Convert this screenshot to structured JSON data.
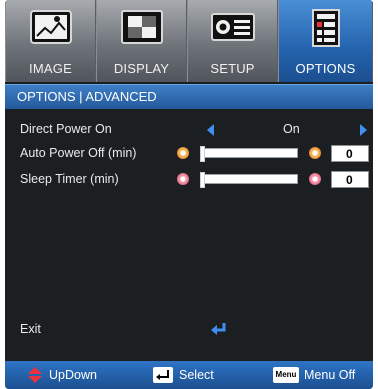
{
  "tabs": [
    {
      "label": "IMAGE",
      "icon": "image-icon"
    },
    {
      "label": "DISPLAY",
      "icon": "display-icon"
    },
    {
      "label": "SETUP",
      "icon": "projector-icon"
    },
    {
      "label": "OPTIONS",
      "icon": "options-icon",
      "active": true
    }
  ],
  "header": {
    "title": "OPTIONS | ADVANCED"
  },
  "settings": {
    "direct_power_on": {
      "label": "Direct Power On",
      "value": "On"
    },
    "auto_power_off": {
      "label": "Auto Power Off (min)",
      "value": "0",
      "slider_level": 0
    },
    "sleep_timer": {
      "label": "Sleep Timer (min)",
      "value": "0",
      "slider_level": 0
    }
  },
  "exit": {
    "label": "Exit"
  },
  "footer": {
    "updown": "UpDown",
    "select": "Select",
    "menu_key": "Menu",
    "menu_off": "Menu Off"
  },
  "colors": {
    "accent": "#2f6fb9",
    "arrow": "#3f8ef0",
    "updown_icon": "#e8323c"
  }
}
